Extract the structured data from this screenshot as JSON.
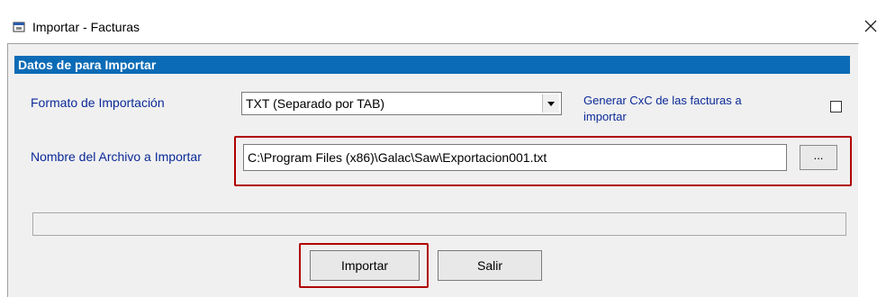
{
  "window": {
    "title": "Importar - Facturas",
    "close_symbol": "✕",
    "icon": "window-icon"
  },
  "section": {
    "header": "Datos de para  Importar"
  },
  "form": {
    "format_label": "Formato de Importación",
    "format_value": "TXT (Separado por TAB)",
    "generate_label_line1": "Generar CxC de las facturas  a",
    "generate_label_line2": "importar",
    "generate_checked": false,
    "file_label": "Nombre del Archivo a Importar",
    "file_value": "C:\\Program Files (x86)\\Galac\\Saw\\Exportacion001.txt",
    "browse_label": "..."
  },
  "progress": {
    "value": 0
  },
  "buttons": {
    "import_label": "Importar",
    "exit_label": "Salir"
  },
  "colors": {
    "section_header": "#0c6bb6",
    "label_text": "#0b2a97",
    "highlight": "#b00000"
  }
}
